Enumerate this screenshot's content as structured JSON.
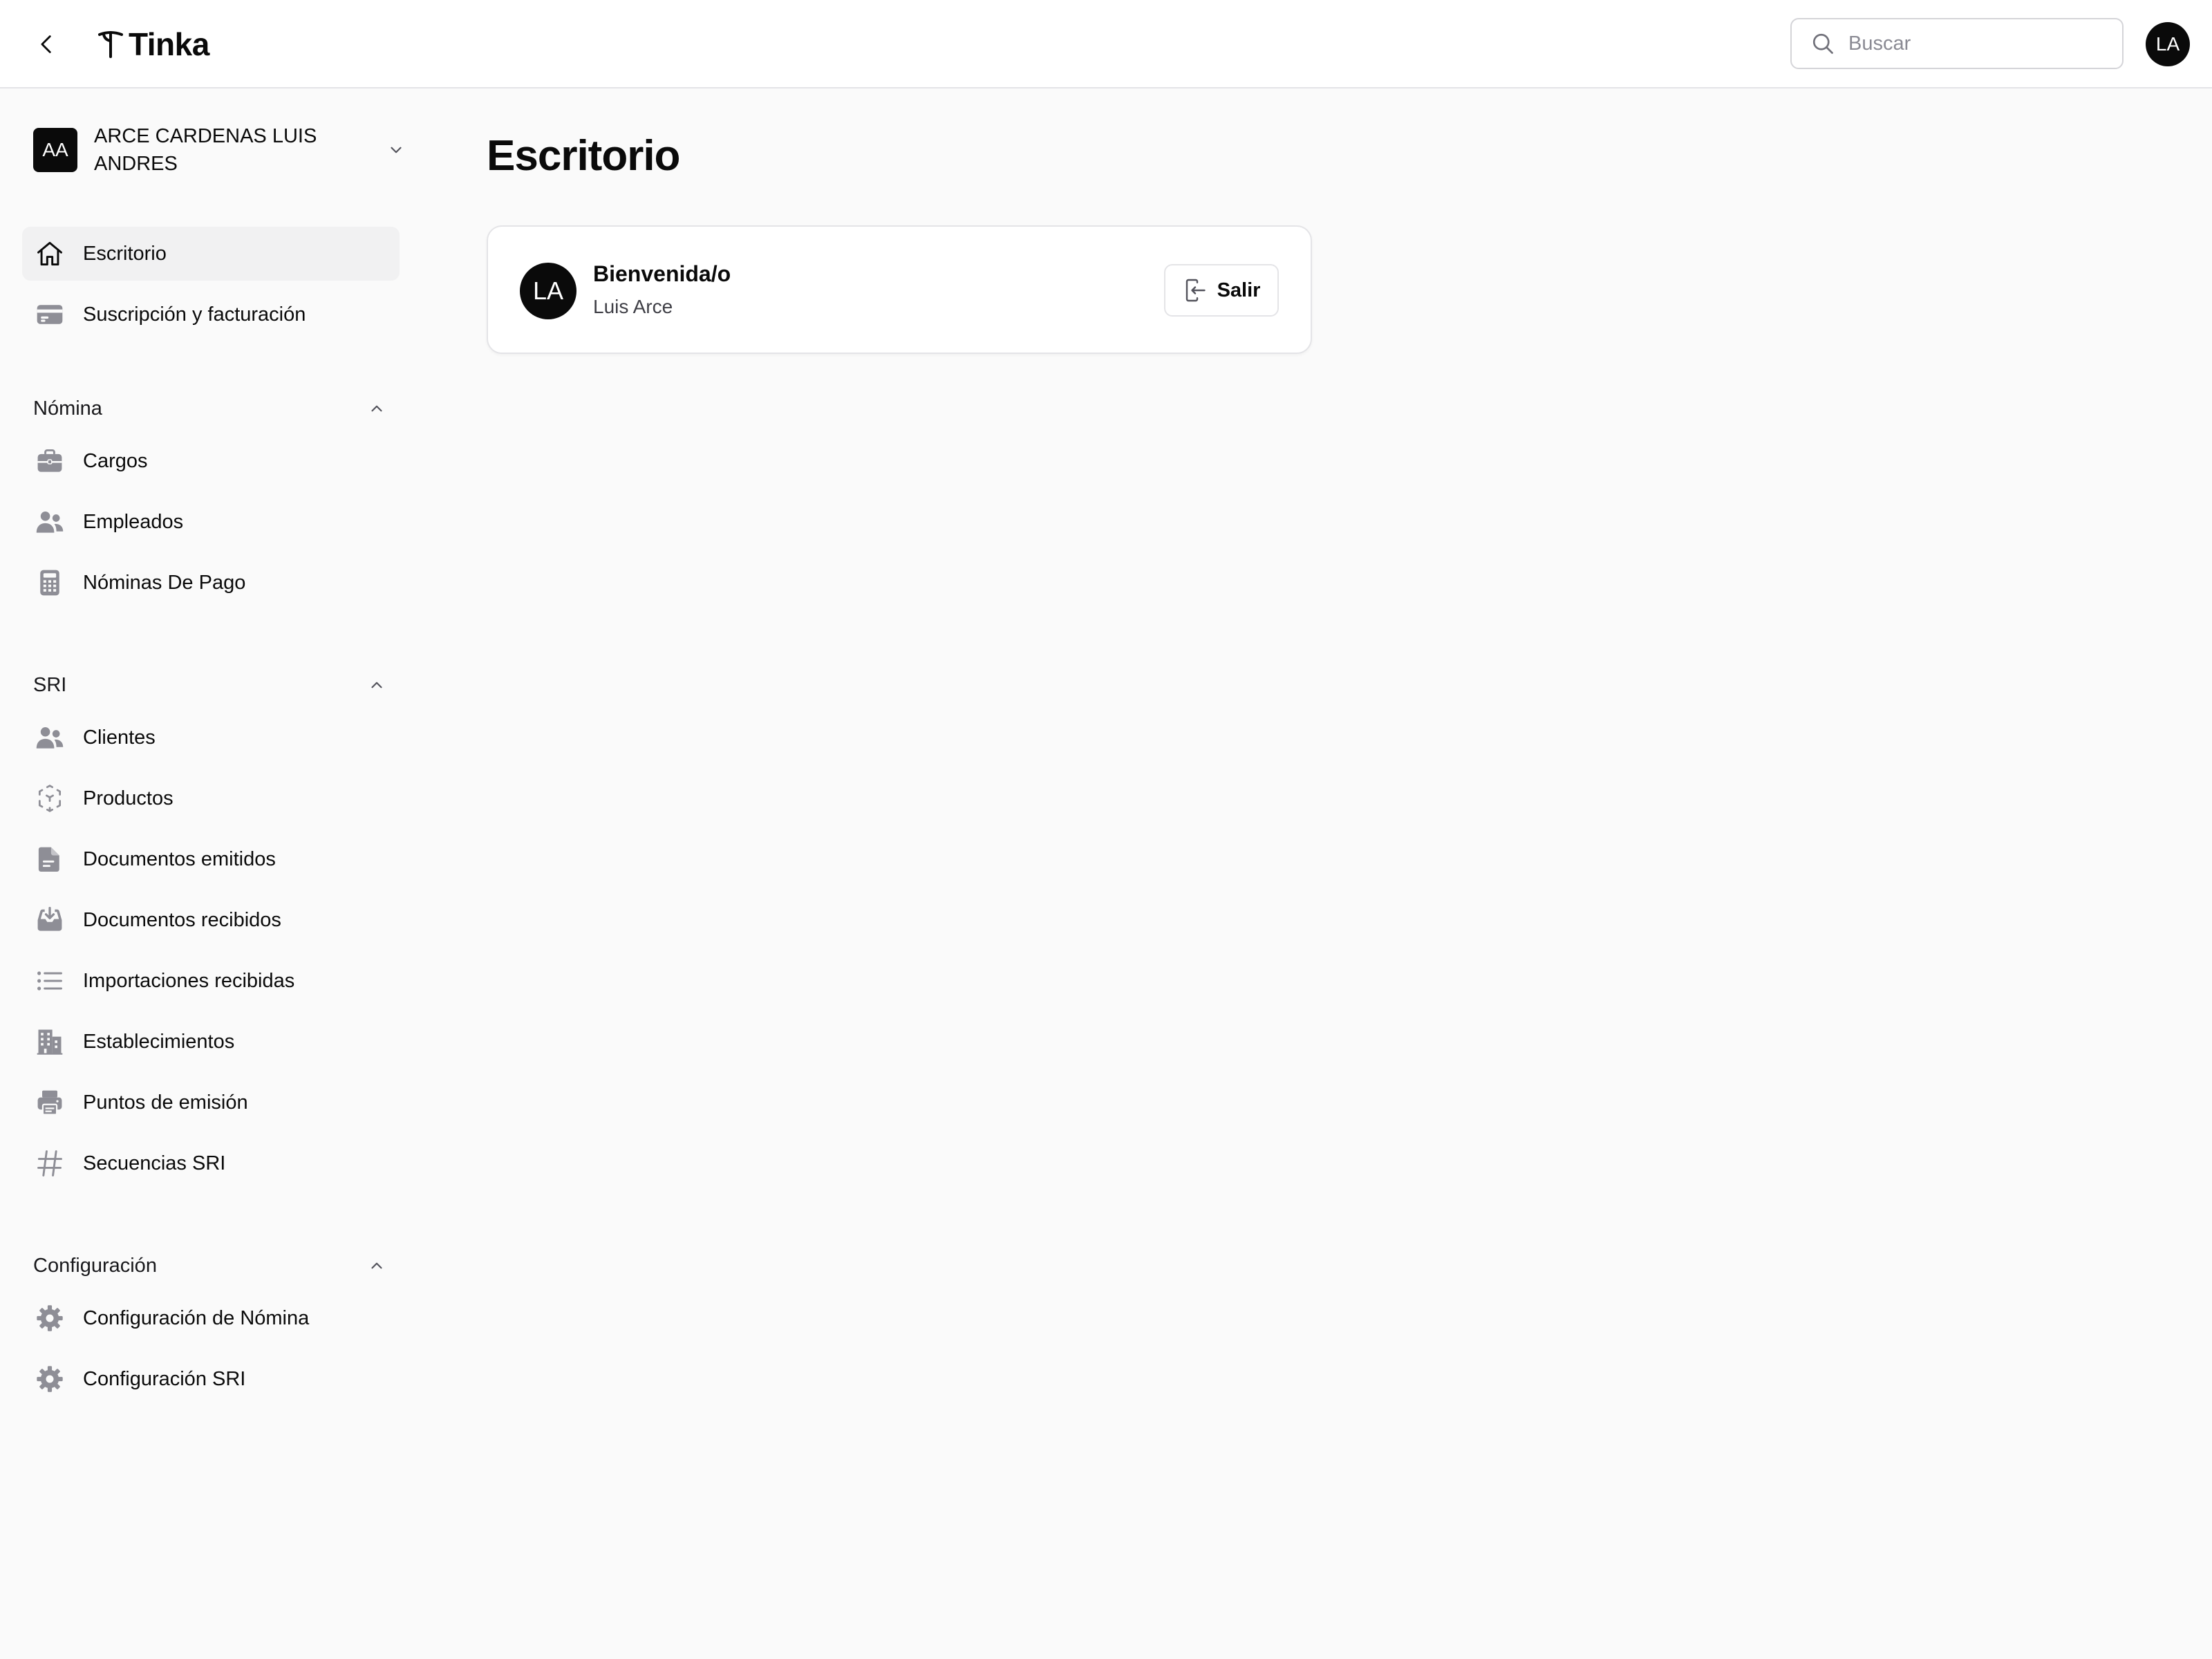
{
  "header": {
    "brand_name": "Tinka",
    "search_placeholder": "Buscar",
    "search_value": "",
    "user_initials": "LA"
  },
  "sidebar": {
    "org": {
      "initials": "AA",
      "name": "ARCE CARDENAS LUIS ANDRES"
    },
    "top_items": [
      {
        "label": "Escritorio",
        "icon": "home-icon",
        "active": true
      },
      {
        "label": "Suscripción y facturación",
        "icon": "credit-card-icon",
        "active": false
      }
    ],
    "sections": [
      {
        "title": "Nómina",
        "expanded": true,
        "items": [
          {
            "label": "Cargos",
            "icon": "briefcase-icon"
          },
          {
            "label": "Empleados",
            "icon": "users-icon"
          },
          {
            "label": "Nóminas De Pago",
            "icon": "calculator-icon"
          }
        ]
      },
      {
        "title": "SRI",
        "expanded": true,
        "items": [
          {
            "label": "Clientes",
            "icon": "users-icon"
          },
          {
            "label": "Productos",
            "icon": "cube-icon"
          },
          {
            "label": "Documentos emitidos",
            "icon": "document-icon"
          },
          {
            "label": "Documentos recibidos",
            "icon": "inbox-download-icon"
          },
          {
            "label": "Importaciones recibidas",
            "icon": "list-icon"
          },
          {
            "label": "Establecimientos",
            "icon": "building-icon"
          },
          {
            "label": "Puntos de emisión",
            "icon": "printer-icon"
          },
          {
            "label": "Secuencias SRI",
            "icon": "hashtag-icon"
          }
        ]
      },
      {
        "title": "Configuración",
        "expanded": true,
        "items": [
          {
            "label": "Configuración de Nómina",
            "icon": "gear-icon"
          },
          {
            "label": "Configuración SRI",
            "icon": "gear-icon"
          }
        ]
      }
    ]
  },
  "main": {
    "page_title": "Escritorio",
    "welcome": {
      "initials": "LA",
      "title": "Bienvenida/o",
      "user_name": "Luis Arce",
      "logout_label": "Salir"
    }
  },
  "colors": {
    "page_bg": "#fafafa",
    "surface": "#ffffff",
    "border": "#e4e4e7",
    "icon_gray": "#8e8e96",
    "text": "#0a0a0a",
    "avatar_bg": "#0a0a0a",
    "active_bg": "#f1f1f2"
  }
}
